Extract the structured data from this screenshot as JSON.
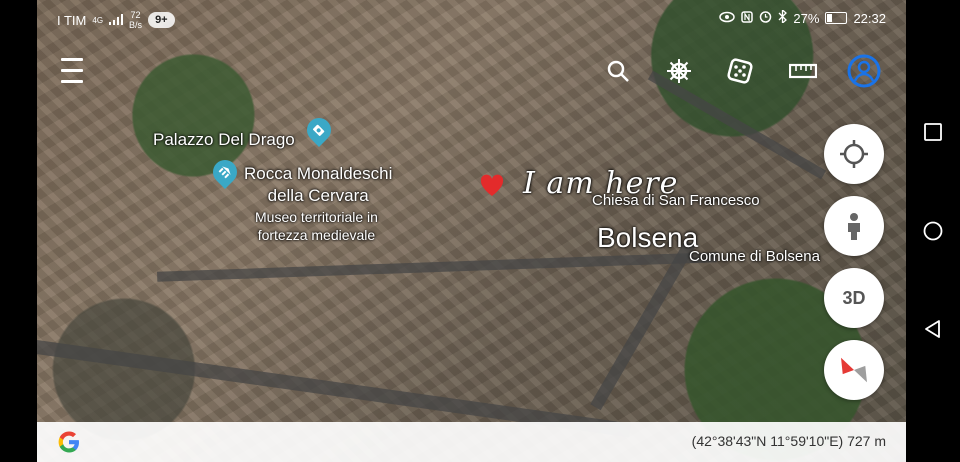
{
  "status_bar": {
    "carrier": "I TIM",
    "network": "4G",
    "speed_value": "72",
    "speed_unit": "B/s",
    "notification_badge": "9+",
    "battery": "27%",
    "battery_level": 0.27,
    "time": "22:32"
  },
  "map": {
    "places": {
      "palazzo": "Palazzo Del Drago",
      "rocca_line1": "Rocca Monaldeschi",
      "rocca_line2": "della Cervara",
      "rocca_sub1": "Museo territoriale in",
      "rocca_sub2": "fortezza medievale",
      "chiesa": "Chiesa di San Francesco",
      "town": "Bolsena",
      "comune": "Comune di Bolsena"
    },
    "annotation": "I am here"
  },
  "controls": {
    "three_d_label": "3D"
  },
  "bottom_bar": {
    "coordinates": "(42°38'43\"N 11°59'10\"E) 727 m"
  },
  "colors": {
    "pin": "#3aa8c6",
    "heart": "#e32b2b",
    "profile": "#1a73e8",
    "compass_red": "#e53935"
  }
}
